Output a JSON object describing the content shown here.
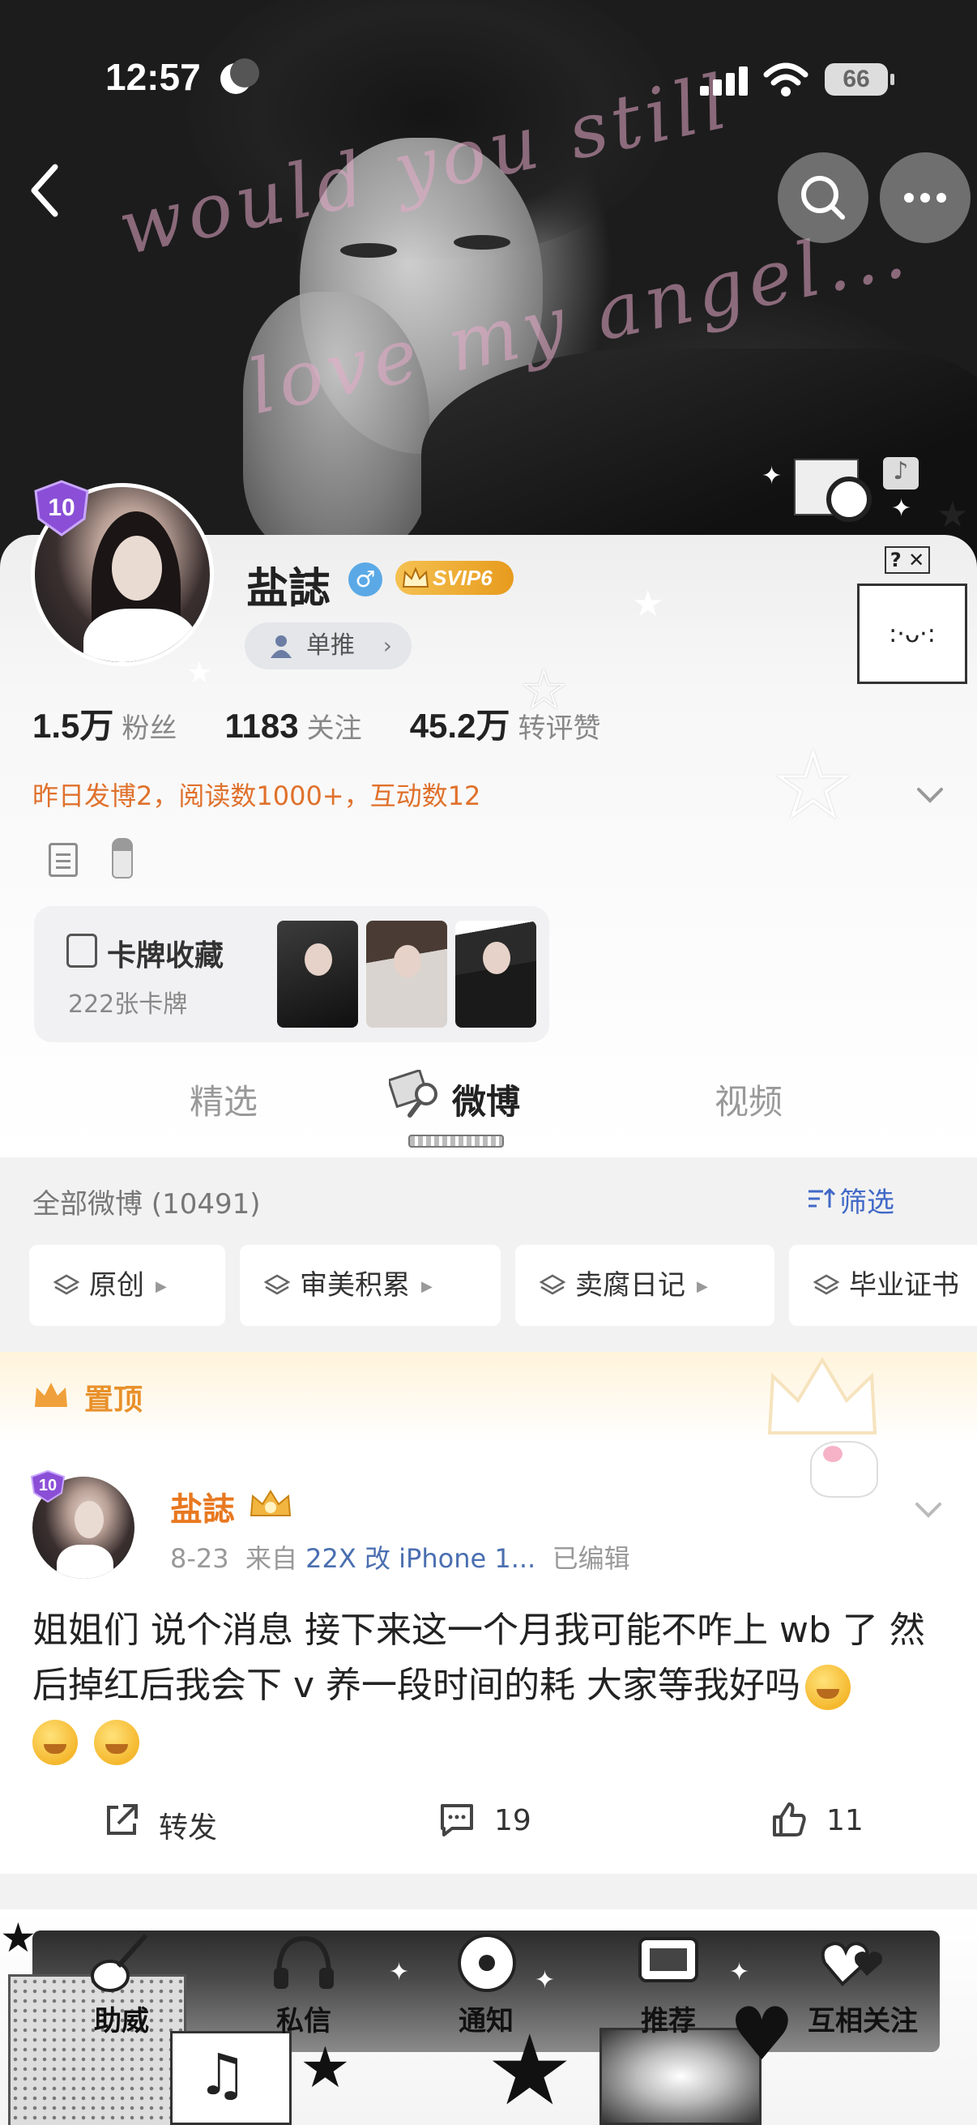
{
  "status": {
    "time": "12:57",
    "battery": "66"
  },
  "cover": {
    "script_line1": "would you still",
    "script_line2": "love my angel..."
  },
  "profile": {
    "level": "10",
    "name": "盐誌",
    "gender_symbol": "♂",
    "vip_badge": "SVIP6",
    "pill_label": "单推",
    "pill_chevron": "›",
    "stats": [
      {
        "value": "1.5万",
        "label": "粉丝"
      },
      {
        "value": "1183",
        "label": "关注"
      },
      {
        "value": "45.2万",
        "label": "转评赞"
      }
    ],
    "activity": "昨日发博2，阅读数1000+，互动数12"
  },
  "card_collection": {
    "title": "卡牌收藏",
    "subtitle": "222张卡牌"
  },
  "tabs": [
    {
      "label": "精选",
      "active": false
    },
    {
      "label": "微博",
      "active": true
    },
    {
      "label": "视频",
      "active": false
    }
  ],
  "feed": {
    "all_count": "全部微博 (10491)",
    "filter_label": "筛选",
    "chips": [
      "原创",
      "审美积累",
      "卖腐日记",
      "毕业证书"
    ]
  },
  "pinned": {
    "label": "置顶"
  },
  "post": {
    "level": "10",
    "author": "盐誌",
    "date": "8-23",
    "source_prefix": "来自",
    "source": "22X 改 iPhone 1...",
    "edited": "已编辑",
    "text": "姐姐们 说个消息 接下来这一个月我可能不咋上 wb 了 然后掉红后我会下 v 养一段时间的耗 大家等我好吗",
    "repost_label": "转发",
    "comment_count": "19",
    "like_count": "11"
  },
  "bottom_tabs": [
    "助威",
    "私信",
    "通知",
    "推荐",
    "互相关注"
  ],
  "colors": {
    "accent_orange": "#e8781f",
    "link_blue": "#4169c7",
    "vip_gold": "#f5c152",
    "gender_blue": "#5aa9e6"
  },
  "icons": [
    "back-arrow-icon",
    "search-icon",
    "more-icon",
    "user-icon",
    "chevron-down-icon",
    "document-icon",
    "salt-shaker-icon",
    "card-icon",
    "filter-icon",
    "layers-icon",
    "crown-icon",
    "share-icon",
    "comment-icon",
    "like-icon"
  ]
}
